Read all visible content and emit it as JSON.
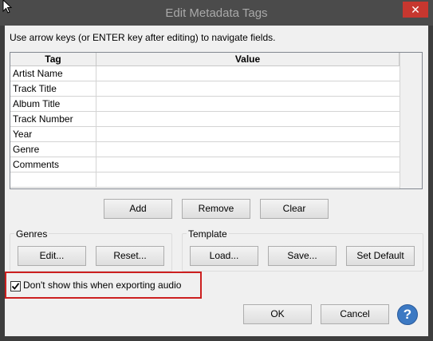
{
  "window": {
    "title": "Edit Metadata Tags",
    "close_glyph": "✕"
  },
  "instructions": "Use arrow keys (or ENTER key after editing) to navigate fields.",
  "table": {
    "columns": [
      "Tag",
      "Value"
    ],
    "rows": [
      {
        "tag": "Artist Name",
        "value": ""
      },
      {
        "tag": "Track Title",
        "value": ""
      },
      {
        "tag": "Album Title",
        "value": ""
      },
      {
        "tag": "Track Number",
        "value": ""
      },
      {
        "tag": "Year",
        "value": ""
      },
      {
        "tag": "Genre",
        "value": ""
      },
      {
        "tag": "Comments",
        "value": ""
      },
      {
        "tag": "",
        "value": ""
      }
    ]
  },
  "row_buttons": {
    "add": "Add",
    "remove": "Remove",
    "clear": "Clear"
  },
  "genres": {
    "label": "Genres",
    "edit": "Edit...",
    "reset": "Reset..."
  },
  "template": {
    "label": "Template",
    "load": "Load...",
    "save": "Save...",
    "set_default": "Set Default"
  },
  "dont_show": {
    "label": "Don't show this when exporting audio",
    "checked": true,
    "check_glyph": "✔"
  },
  "footer": {
    "ok": "OK",
    "cancel": "Cancel",
    "help_glyph": "?"
  },
  "colors": {
    "highlight_border": "#cc1f1f",
    "help_blue": "#3c79c3",
    "close_red": "#c7372f"
  }
}
